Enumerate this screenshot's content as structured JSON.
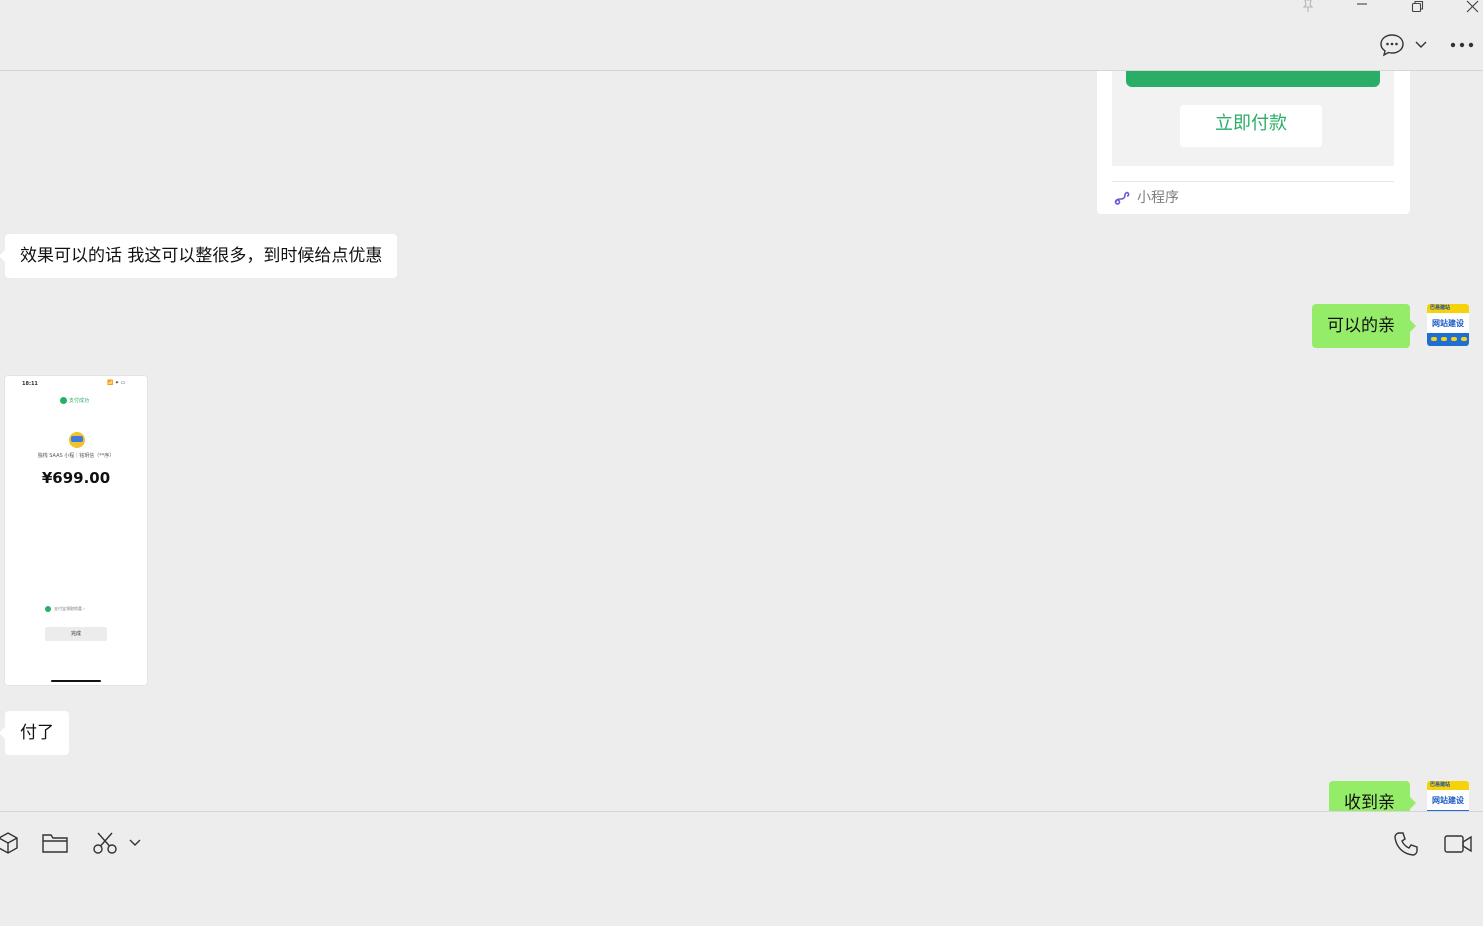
{
  "window": {
    "title_bar_icons": [
      "pin-icon",
      "minimize-icon",
      "restore-icon",
      "close-icon"
    ],
    "header_actions": [
      "chat-bubble-icon",
      "chevron-down-icon",
      "more-icon"
    ]
  },
  "chat": {
    "mini_program_card": {
      "pay_button_label": "立即付款",
      "footer_label": "小程序",
      "accent_color": "#2aae67"
    },
    "messages": [
      {
        "side": "left",
        "text": "效果可以的话 我这可以整很多，到时候给点优惠"
      },
      {
        "side": "right",
        "text": "可以的亲"
      },
      {
        "side": "left",
        "type": "image",
        "image": {
          "status_time": "18:11",
          "status_icons": "📶 ✦ ▭",
          "badge": "支付成功",
          "merchant": "独栈 SAAS 小程｜铭玥信（**序）",
          "amount": "¥699.00",
          "footer": "支付宝领取惊喜 ›",
          "done_button": "完成"
        }
      },
      {
        "side": "left",
        "text": "付了"
      },
      {
        "side": "right",
        "text": "收到亲"
      }
    ],
    "avatar": {
      "tag": "巴易建站",
      "text": "网站建设"
    }
  },
  "toolbar": {
    "left_icons": [
      "cube-icon",
      "folder-icon",
      "scissors-icon",
      "chevron-down-icon"
    ],
    "right_icons": [
      "phone-icon",
      "video-icon"
    ]
  },
  "colors": {
    "background": "#ededed",
    "bubble_self": "#95ec69",
    "bubble_other": "#ffffff"
  }
}
